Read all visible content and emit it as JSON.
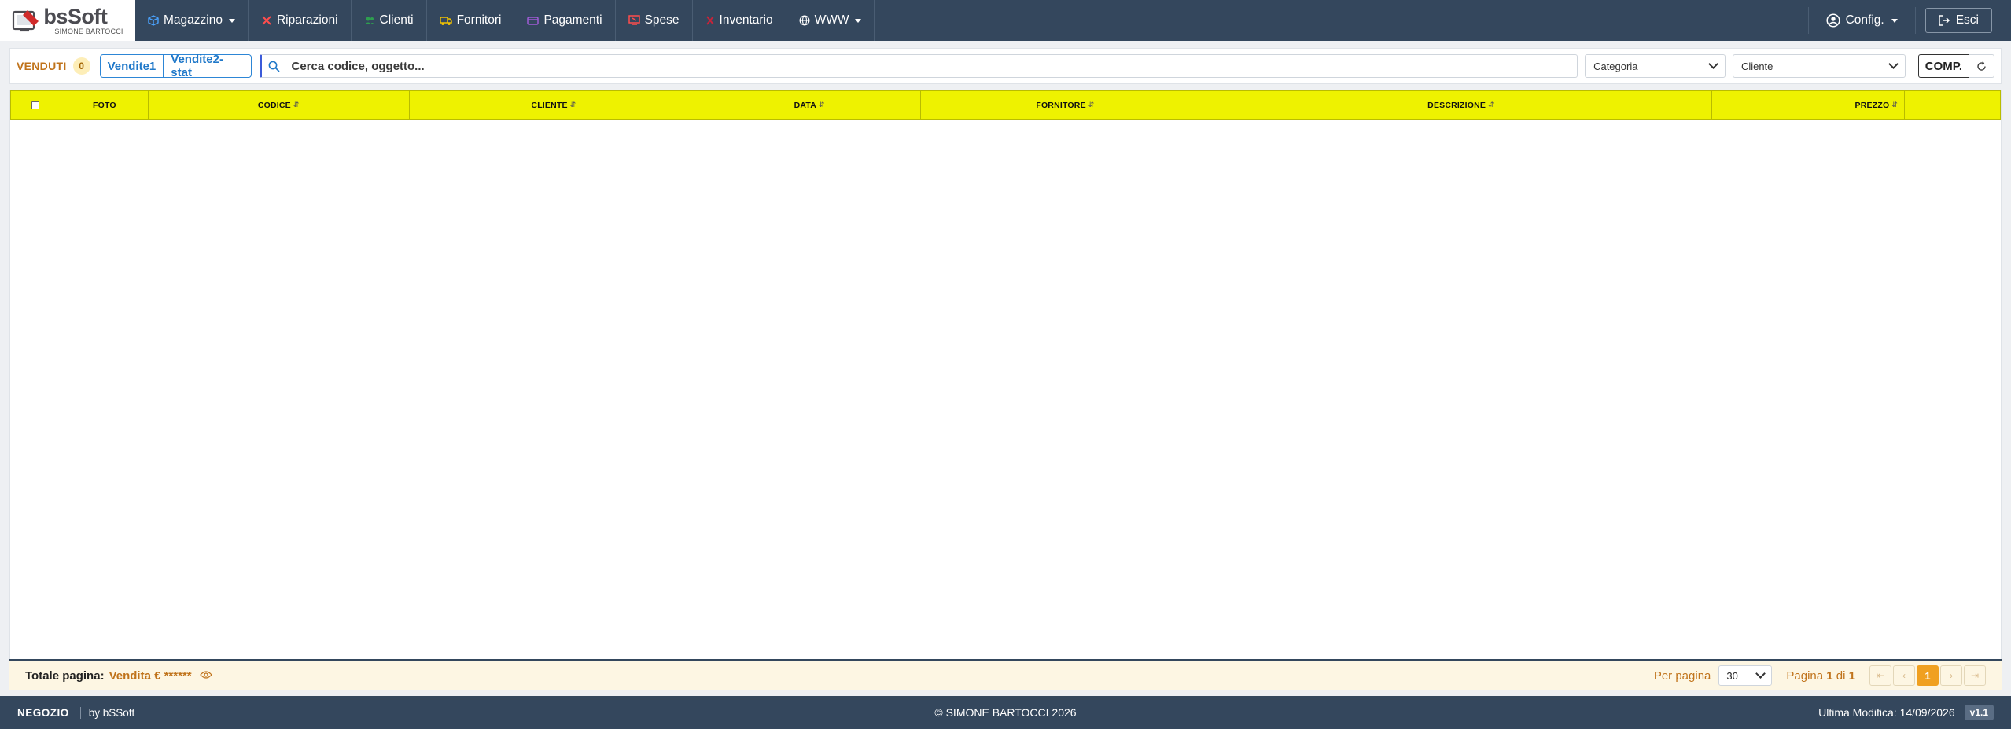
{
  "app": {
    "brand_name": "bsSoft",
    "brand_sub": "SIMONE BARTOCCI"
  },
  "nav": {
    "items": [
      {
        "label": "Magazzino",
        "icon": "box-icon",
        "color": "#4aa3ff",
        "dropdown": true
      },
      {
        "label": "Riparazioni",
        "icon": "tools-icon",
        "color": "#ff4d4d",
        "dropdown": false
      },
      {
        "label": "Clienti",
        "icon": "users-icon",
        "color": "#2e9e4f",
        "dropdown": false
      },
      {
        "label": "Fornitori",
        "icon": "truck-icon",
        "color": "#f2c200",
        "dropdown": false
      },
      {
        "label": "Pagamenti",
        "icon": "card-icon",
        "color": "#a05cd6",
        "dropdown": false
      },
      {
        "label": "Spese",
        "icon": "receipt-icon",
        "color": "#ff4d4d",
        "dropdown": false
      },
      {
        "label": "Inventario",
        "icon": "clipboard-icon",
        "color": "#c4243a",
        "dropdown": false
      },
      {
        "label": "WWW",
        "icon": "globe-icon",
        "color": "#ffffff",
        "dropdown": true
      }
    ],
    "config_label": "Config.",
    "logout_label": "Esci"
  },
  "toolbar": {
    "venduti_label": "VENDUTI",
    "venduti_count": "0",
    "tab1_label": "Vendite1",
    "tab2_label": "Vendite2-stat",
    "search_placeholder": "Cerca codice, oggetto...",
    "category_value": "Categoria",
    "client_value": "Cliente",
    "comp_label": "COMP."
  },
  "table": {
    "columns": [
      "FOTO",
      "CODICE",
      "CLIENTE",
      "DATA",
      "FORNITORE",
      "DESCRIZIONE",
      "PREZZO"
    ],
    "rows": []
  },
  "totals": {
    "label": "Totale pagina:",
    "value": "Vendita € ******",
    "per_page_label": "Per pagina",
    "per_page_value": "30",
    "page_word": "Pagina",
    "page_current": "1",
    "page_of": "di",
    "page_total": "1",
    "active_page": "1"
  },
  "status": {
    "shop": "NEGOZIO",
    "by": "by bSSoft",
    "copyright": "© SIMONE BARTOCCI 2026",
    "last_modified": "Ultima Modifica: 14/09/2026",
    "version": "v1.1"
  },
  "colors": {
    "navbar": "#34475d",
    "header_yellow": "#eef200",
    "accent_orange": "#c0731b",
    "accent_blue": "#1f78c9"
  }
}
